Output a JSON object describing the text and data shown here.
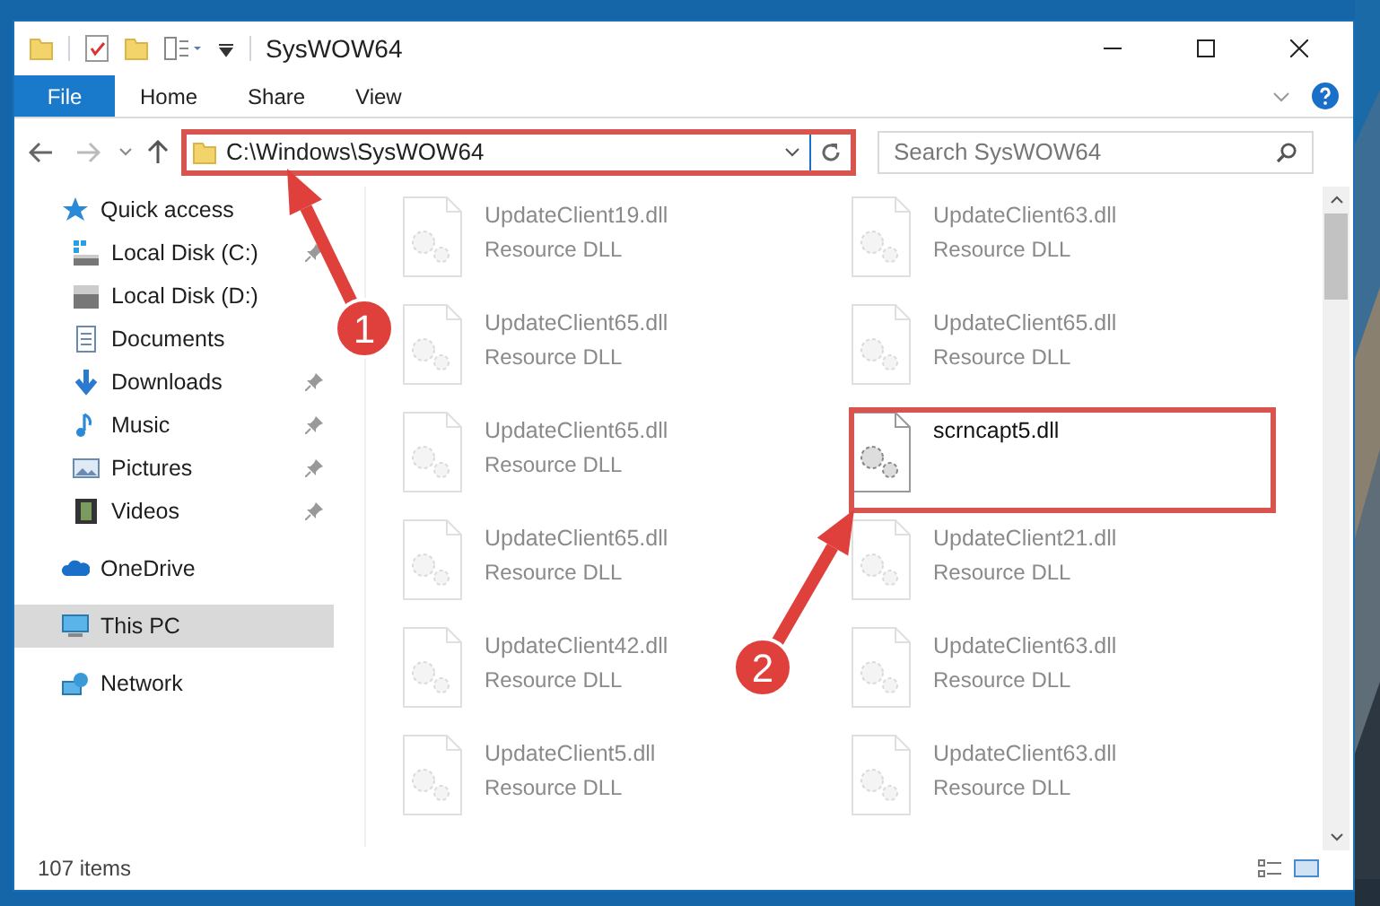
{
  "window": {
    "title": "SysWOW64"
  },
  "ribbon_tabs": [
    {
      "label": "File",
      "selected": true
    },
    {
      "label": "Home",
      "selected": false
    },
    {
      "label": "Share",
      "selected": false
    },
    {
      "label": "View",
      "selected": false
    }
  ],
  "address_bar": {
    "value": "C:\\Windows\\SysWOW64"
  },
  "search": {
    "placeholder": "Search SysWOW64"
  },
  "sidebar": {
    "items": [
      {
        "label": "Quick access",
        "selected": false,
        "children": [
          {
            "label": "Local Disk (C:)",
            "pinned": true,
            "selected": false
          },
          {
            "label": "Local Disk (D:)",
            "selected": false
          },
          {
            "label": "Documents",
            "selected": false
          },
          {
            "label": "Downloads",
            "pinned": true,
            "selected": false
          },
          {
            "label": "Music",
            "pinned": true,
            "selected": false
          },
          {
            "label": "Pictures",
            "pinned": true,
            "selected": false
          },
          {
            "label": "Videos",
            "pinned": true,
            "selected": false
          }
        ]
      },
      {
        "label": "OneDrive",
        "selected": false
      },
      {
        "label": "This PC",
        "selected": true
      },
      {
        "label": "Network",
        "selected": false
      }
    ]
  },
  "files": [
    {
      "name": "UpdateClient19.dll",
      "type": "Resource DLL",
      "faded": true
    },
    {
      "name": "UpdateClient63.dll",
      "type": "Resource DLL",
      "faded": true
    },
    {
      "name": "UpdateClient65.dll",
      "type": "Resource DLL",
      "faded": true
    },
    {
      "name": "UpdateClient65.dll",
      "type": "Resource DLL",
      "faded": true
    },
    {
      "name": "UpdateClient65.dll",
      "type": "Resource DLL",
      "faded": true
    },
    {
      "name": "scrncapt5.dll",
      "faded": false
    },
    {
      "name": "UpdateClient65.dll",
      "type": "Resource DLL",
      "faded": true
    },
    {
      "name": "UpdateClient21.dll",
      "type": "Resource DLL",
      "faded": true
    },
    {
      "name": "UpdateClient42.dll",
      "type": "Resource DLL",
      "faded": true
    },
    {
      "name": "UpdateClient63.dll",
      "type": "Resource DLL",
      "faded": true
    },
    {
      "name": "UpdateClient5.dll",
      "type": "Resource DLL",
      "faded": true
    },
    {
      "name": "UpdateClient63.dll",
      "type": "Resource DLL",
      "faded": true
    }
  ],
  "status_bar": {
    "item_count": "107 items"
  },
  "annotations": [
    {
      "number": "1"
    },
    {
      "number": "2"
    }
  ]
}
